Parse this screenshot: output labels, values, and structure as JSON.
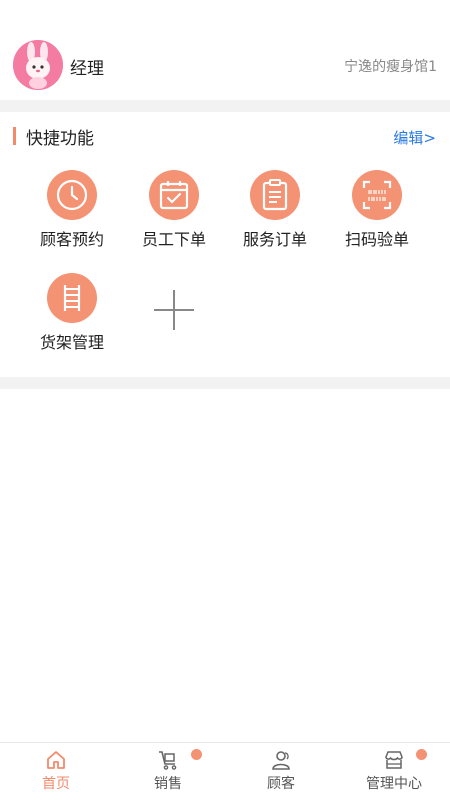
{
  "header": {
    "user_name": "经理",
    "store_name": "宁逸的瘦身馆1",
    "avatar_icon": "bunny-avatar-icon"
  },
  "quick": {
    "title": "快捷功能",
    "edit_label": "编辑>",
    "items": [
      {
        "label": "顾客预约",
        "icon": "clock-icon"
      },
      {
        "label": "员工下单",
        "icon": "calendar-check-icon"
      },
      {
        "label": "服务订单",
        "icon": "clipboard-icon"
      },
      {
        "label": "扫码验单",
        "icon": "scan-barcode-icon"
      },
      {
        "label": "货架管理",
        "icon": "shelf-icon"
      }
    ],
    "add_icon": "plus-icon"
  },
  "tabbar": {
    "tabs": [
      {
        "label": "首页",
        "icon": "home-icon",
        "active": true,
        "badge": false
      },
      {
        "label": "销售",
        "icon": "cart-icon",
        "active": false,
        "badge": true
      },
      {
        "label": "顾客",
        "icon": "users-icon",
        "active": false,
        "badge": false
      },
      {
        "label": "管理中心",
        "icon": "store-icon",
        "active": false,
        "badge": true
      }
    ]
  },
  "colors": {
    "accent": "#f49274",
    "link": "#2a7ae2",
    "avatar_bg": "#f47ca3"
  }
}
